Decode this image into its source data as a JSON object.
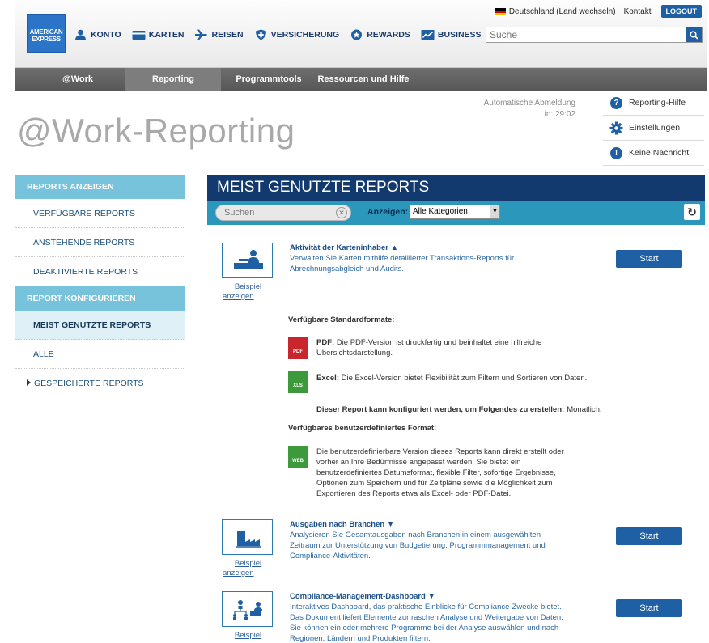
{
  "header": {
    "logo_text": [
      "AMERICAN",
      "EXPRESS"
    ],
    "country": "Deutschland (Land wechseln)",
    "contact": "Kontakt",
    "logout": "LOGOUT",
    "search_placeholder": "Suche",
    "nav": [
      {
        "label": "KONTO",
        "icon": "user-icon"
      },
      {
        "label": "KARTEN",
        "icon": "card-icon"
      },
      {
        "label": "REISEN",
        "icon": "airplane-icon"
      },
      {
        "label": "VERSICHERUNG",
        "icon": "shield-icon"
      },
      {
        "label": "REWARDS",
        "icon": "rewards-icon"
      },
      {
        "label": "BUSINESS",
        "icon": "chart-icon"
      }
    ]
  },
  "subnav": {
    "tabs": [
      {
        "label": "@Work"
      },
      {
        "label": "Reporting"
      },
      {
        "label": "Programmtools"
      },
      {
        "label": "Ressourcen und Hilfe"
      }
    ]
  },
  "page": {
    "title": "@Work-Reporting",
    "autologout_label": "Automatische Abmeldung",
    "autologout_time": "in: 29:02"
  },
  "right_links": [
    {
      "label": "Reporting-Hilfe",
      "icon": "help-icon"
    },
    {
      "label": "Einstellungen",
      "icon": "gear-icon"
    },
    {
      "label": "Keine Nachricht",
      "icon": "alert-icon"
    }
  ],
  "sidebar": {
    "section1": "REPORTS ANZEIGEN",
    "items1": [
      "VERFÜGBARE REPORTS",
      "ANSTEHENDE REPORTS",
      "DEAKTIVIERTE REPORTS"
    ],
    "section2": "REPORT KONFIGURIEREN",
    "items2": [
      "MEIST GENUTZTE REPORTS",
      "ALLE",
      "GESPEICHERTE REPORTS"
    ]
  },
  "content": {
    "heading": "MEIST GENUTZTE REPORTS",
    "search_placeholder": "Suchen",
    "show_label": "Anzeigen:",
    "category": "Alle Kategorien"
  },
  "reports": [
    {
      "title": "Aktivität der Karteninhaber ▲",
      "desc": "Verwalten Sie Karten mithilfe detaillierter Transaktions-Reports für Abrechnungsabgleich und Audits.",
      "beispiel": [
        "Beispiel",
        "anzeigen"
      ],
      "start": "Start"
    },
    {
      "title": "Ausgaben nach Branchen ▼",
      "desc": "Analysieren Sie Gesamtausgaben nach Branchen in einem ausgewählten Zeitraum zur Unterstützung von Budgetierung, Programmmanagement und Compliance-Aktivitäten.",
      "beispiel": [
        "Beispiel",
        "anzeigen"
      ],
      "start": "Start"
    },
    {
      "title": "Compliance-Management-Dashboard ▼",
      "desc": "Interaktives Dashboard, das praktische Einblicke für Compliance-Zwecke bietet. Das Dokument liefert Elemente zur raschen Analyse und Weitergabe von Daten. Sie können ein oder mehrere Programme bei der Analyse auswählen und nach Regionen, Ländern und Produkten filtern.",
      "beispiel": [
        "Beispiel",
        ""
      ],
      "start": "Start"
    }
  ],
  "formats": {
    "standard_label": "Verfügbare Standardformate:",
    "pdf_icon": "PDF",
    "pdf_name": "PDF:",
    "pdf_text": "Die PDF-Version ist druckfertig und beinhaltet eine hilfreiche Übersichtsdarstellung.",
    "xls_icon": "XLS",
    "xls_name": "Excel:",
    "xls_text": "Die Excel-Version bietet Flexibilität zum Filtern und Sortieren von Daten.",
    "config_label": "Dieser Report kann konfiguriert werden, um Folgendes zu erstellen:",
    "config_value": "Monatlich.",
    "custom_label": "Verfügbares benutzerdefiniertes Format:",
    "web_icon": "WEB",
    "web_text": "Die benutzerdefinierbare Version dieses Reports kann direkt erstellt oder vorher an Ihre Bedürfnisse angepasst werden.  Sie bietet ein benutzerdefiniertes Datumsformat, flexible Filter, sofortige Ergebnisse, Optionen zum Speichern und für Zeitpläne sowie die Möglichkeit zum Exportieren des Reports etwa als Excel- oder PDF-Datei."
  },
  "colors": {
    "brand_blue": "#1f5fa3",
    "header_navy": "#133a6f",
    "filter_teal": "#2a97bb",
    "sidebar_head": "#77c3dc"
  }
}
